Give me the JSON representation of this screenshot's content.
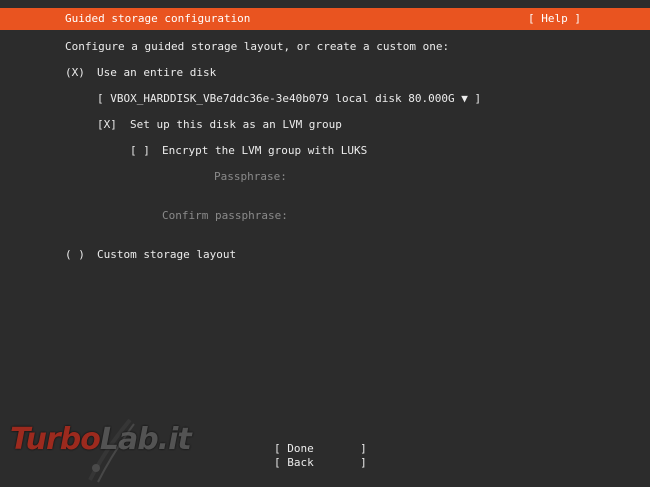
{
  "header": {
    "title": "Guided storage configuration",
    "help_button": "[ Help ]"
  },
  "intro": "Configure a guided storage layout, or create a custom one:",
  "option_entire_disk": {
    "radio": "(X)",
    "label": "Use an entire disk"
  },
  "disk_select": {
    "value": "[ VBOX_HARDDISK_VBe7ddc36e-3e40b079 local disk 80.000G ▼ ]"
  },
  "lvm": {
    "checkbox": "[X]",
    "label": "Set up this disk as an LVM group"
  },
  "luks": {
    "checkbox": "[ ]",
    "label": "Encrypt the LVM group with LUKS"
  },
  "passphrase_label": "Passphrase:",
  "confirm_passphrase_label": "Confirm passphrase:",
  "option_custom": {
    "radio": "( )",
    "label": "Custom storage layout"
  },
  "buttons": {
    "done": "[ Done       ]",
    "back": "[ Back       ]"
  },
  "watermark": {
    "text_part1": "Turbo",
    "text_part2": "Lab.it"
  },
  "colors": {
    "accent": "#e95420",
    "background": "#2c2c2c",
    "text": "#ececec",
    "dim_text": "#8a8a8a"
  }
}
